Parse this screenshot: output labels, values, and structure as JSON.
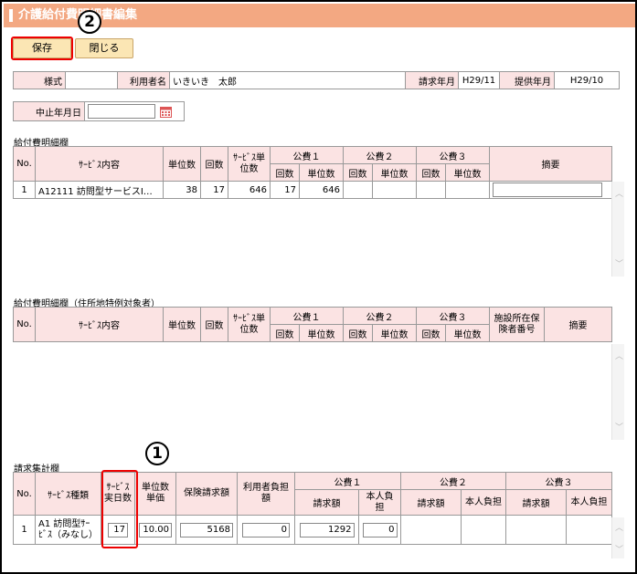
{
  "header": {
    "title": "介護給付費明細書編集"
  },
  "toolbar": {
    "save_label": "保存",
    "close_label": "閉じる"
  },
  "callouts": {
    "one": "1",
    "two": "2"
  },
  "info": {
    "format_label": "様式",
    "format_value": "",
    "user_label": "利用者名",
    "user_value": "いきいき　太郎",
    "claim_month_label": "請求年月",
    "claim_month_value": "H29/11",
    "service_month_label": "提供年月",
    "service_month_value": "H29/10"
  },
  "stop_date": {
    "label": "中止年月日",
    "value": ""
  },
  "detail": {
    "title": "給付費明細欄",
    "headers": {
      "no": "No.",
      "service": "ｻｰﾋﾞｽ内容",
      "unit": "単位数",
      "count": "回数",
      "service_units": "ｻｰﾋﾞｽ単位数",
      "pub1": "公費１",
      "pub2": "公費２",
      "pub3": "公費３",
      "sub_count": "回数",
      "sub_unit": "単位数",
      "memo": "摘要"
    },
    "rows": [
      {
        "no": "1",
        "service": "A12111 訪問型サービスⅠ…",
        "unit": "38",
        "count": "17",
        "service_units": "646",
        "p1_count": "17",
        "p1_units": "646",
        "p2_count": "",
        "p2_units": "",
        "p3_count": "",
        "p3_units": "",
        "memo": ""
      }
    ]
  },
  "detail_special": {
    "title": "給付費明細欄（住所地特例対象者）",
    "headers": {
      "no": "No.",
      "service": "ｻｰﾋﾞｽ内容",
      "unit": "単位数",
      "count": "回数",
      "service_units": "ｻｰﾋﾞｽ単位数",
      "pub1": "公費１",
      "pub2": "公費２",
      "pub3": "公費３",
      "sub_count": "回数",
      "sub_unit": "単位数",
      "facility": "施設所在保険者番号",
      "memo": "摘要"
    }
  },
  "summary": {
    "title": "請求集計欄",
    "headers": {
      "no": "No.",
      "type": "ｻｰﾋﾞｽ種類",
      "days": "ｻｰﾋﾞｽ実日数",
      "unit_price": "単位数単価",
      "insurance": "保険請求額",
      "user_burden": "利用者負担額",
      "pub1": "公費１",
      "pub2": "公費２",
      "pub3": "公費３",
      "claim": "請求額",
      "self": "本人負担"
    },
    "rows": [
      {
        "no": "1",
        "type": "A1 訪問型ｻｰﾋﾞｽ（みなし）",
        "days": "17",
        "unit_price": "10.00",
        "insurance": "5168",
        "user_burden": "0",
        "p1_claim": "1292",
        "p1_self": "0"
      }
    ]
  },
  "icons": {
    "calendar": "calendar-icon",
    "scroll_up": "chevron-up-icon",
    "scroll_down": "chevron-down-icon"
  },
  "colors": {
    "titlebar": "#f3a882",
    "header_cell": "#fbe3e3",
    "button": "#fbe6b4",
    "highlight": "#e00000"
  }
}
